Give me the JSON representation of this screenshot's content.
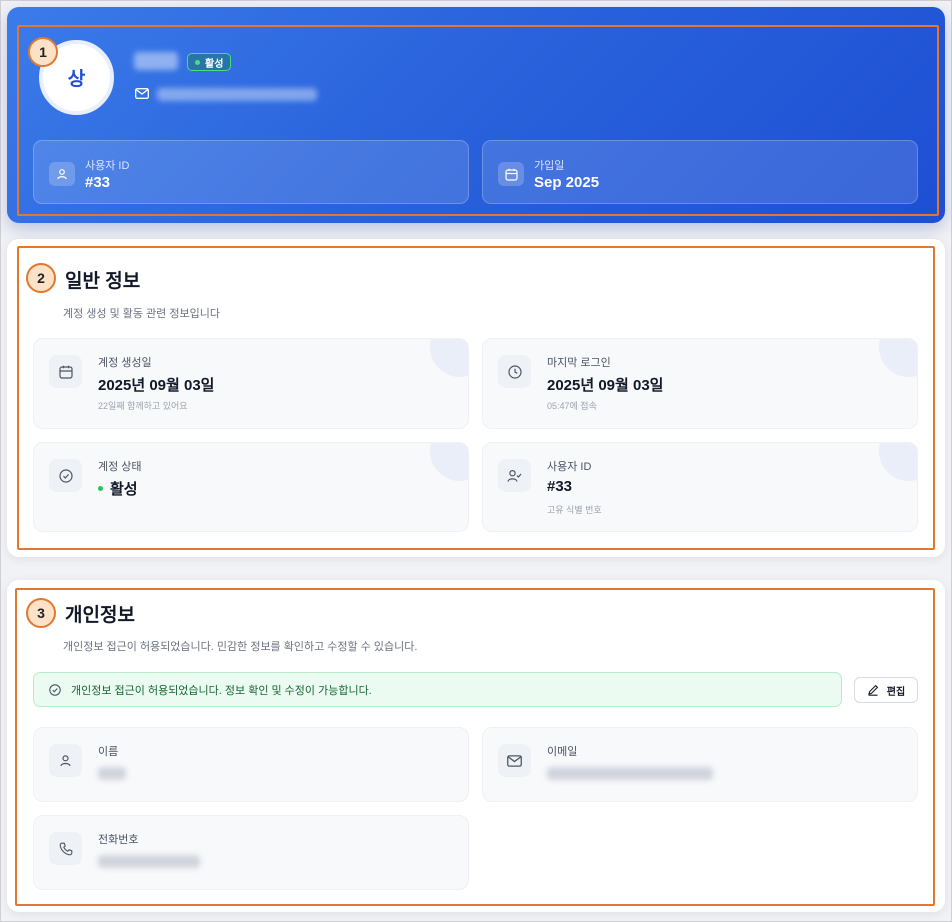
{
  "profile": {
    "avatar_initial": "상",
    "status_badge": "활성",
    "stats": [
      {
        "label": "사용자 ID",
        "value": "#33",
        "icon": "user-icon"
      },
      {
        "label": "가입일",
        "value": "Sep 2025",
        "icon": "calendar-icon"
      }
    ]
  },
  "general": {
    "title": "일반 정보",
    "subtitle": "계정 생성 및 활동 관련 정보입니다",
    "tiles": [
      {
        "label": "계정 생성일",
        "value": "2025년 09월 03일",
        "sub": "22일째 함께하고 있어요",
        "icon": "calendar-icon"
      },
      {
        "label": "마지막 로그인",
        "value": "2025년 09월 03일",
        "sub": "05:47에 접속",
        "icon": "clock-icon"
      },
      {
        "label": "계정 상태",
        "value": "활성",
        "sub": "",
        "icon": "check-circle-icon"
      },
      {
        "label": "사용자 ID",
        "value": "#33",
        "sub": "고유 식별 번호",
        "icon": "user-check-icon"
      }
    ]
  },
  "personal": {
    "title": "개인정보",
    "subtitle": "개인정보 접근이 허용되었습니다. 민감한 정보를 확인하고 수정할 수 있습니다.",
    "notice": "개인정보 접근이 허용되었습니다. 정보 확인 및 수정이 가능합니다.",
    "edit_label": "편집",
    "fields": [
      {
        "label": "이름",
        "icon": "user-icon"
      },
      {
        "label": "이메일",
        "icon": "mail-icon"
      },
      {
        "label": "전화번호",
        "icon": "phone-icon"
      }
    ]
  },
  "markers": [
    "1",
    "2",
    "3"
  ],
  "colors": {
    "hero_start": "#3b7bea",
    "hero_end": "#1d4fd3",
    "marker": "#e0782f",
    "success": "#22c55e"
  }
}
